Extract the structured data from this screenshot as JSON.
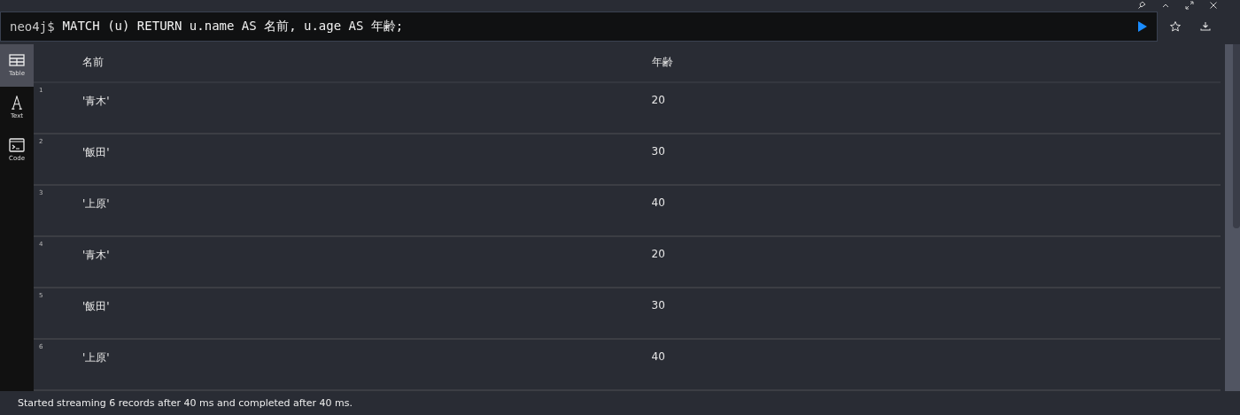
{
  "query": {
    "prompt": "neo4j$",
    "text": "MATCH (u) RETURN u.name AS 名前, u.age AS 年齢;"
  },
  "views": [
    {
      "label": "Table",
      "kind": "table",
      "selected": true
    },
    {
      "label": "Text",
      "kind": "text",
      "selected": false
    },
    {
      "label": "Code",
      "kind": "code",
      "selected": false
    }
  ],
  "table": {
    "columns": [
      "名前",
      "年齢"
    ],
    "rows": [
      {
        "index": "1",
        "cells": [
          "'青木'",
          "20"
        ]
      },
      {
        "index": "2",
        "cells": [
          "'飯田'",
          "30"
        ]
      },
      {
        "index": "3",
        "cells": [
          "'上原'",
          "40"
        ]
      },
      {
        "index": "4",
        "cells": [
          "'青木'",
          "20"
        ]
      },
      {
        "index": "5",
        "cells": [
          "'飯田'",
          "30"
        ]
      },
      {
        "index": "6",
        "cells": [
          "'上原'",
          "40"
        ]
      }
    ]
  },
  "status_bar": "Started streaming 6 records after 40 ms and completed after 40 ms."
}
